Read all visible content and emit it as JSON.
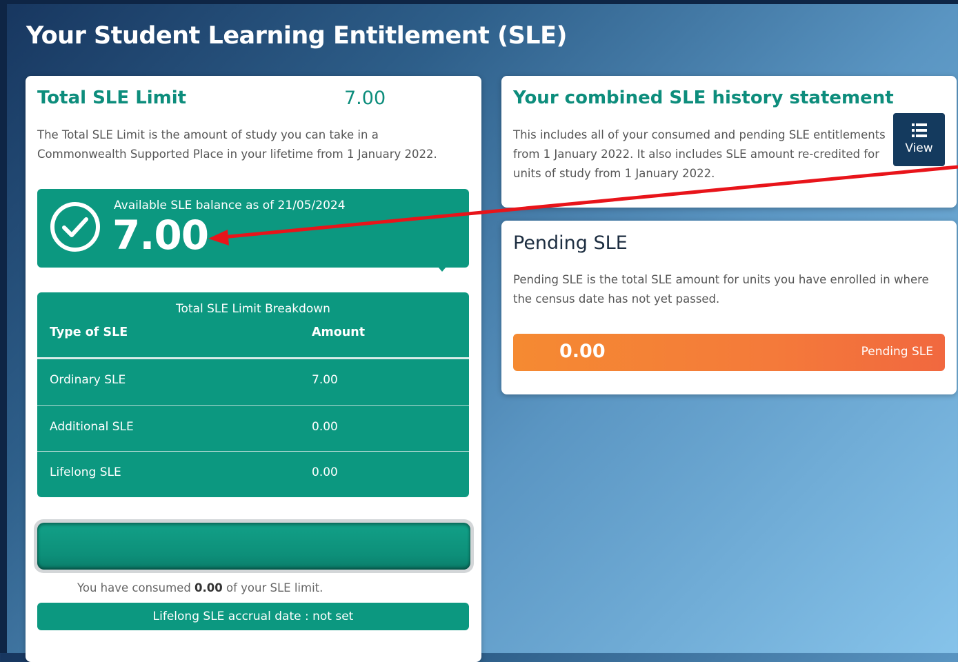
{
  "page": {
    "title": "Your Student Learning Entitlement (SLE)"
  },
  "total_limit": {
    "title": "Total SLE Limit",
    "value": "7.00",
    "description": "The Total SLE Limit is the amount of study you can take in a Commonwealth Supported Place in your lifetime from 1 January 2022."
  },
  "balance": {
    "label": "Available SLE balance as of 21/05/2024",
    "value": "7.00",
    "icon": "check-circle-icon"
  },
  "breakdown": {
    "caption": "Total SLE Limit Breakdown",
    "headers": [
      "Type of SLE",
      "Amount"
    ],
    "rows": [
      {
        "type": "Ordinary SLE",
        "amount": "7.00"
      },
      {
        "type": "Additional SLE",
        "amount": "0.00"
      },
      {
        "type": "Lifelong SLE",
        "amount": "0.00"
      }
    ]
  },
  "consumption": {
    "progress_fraction": 0,
    "text_prefix": "You have consumed",
    "consumed": "0.00",
    "text_suffix": "of your SLE limit."
  },
  "accrual": {
    "text": "Lifelong SLE accrual date : not set"
  },
  "history": {
    "title": "Your combined SLE history statement",
    "description": "This includes all of your consumed and pending SLE entitlements from 1 January 2022. It also includes SLE amount re-credited for units of study from 1 January 2022.",
    "view_label": "View",
    "view_icon": "list-icon"
  },
  "pending": {
    "title": "Pending SLE",
    "description": "Pending SLE is the total SLE amount for units you have enrolled in where the census date has not yet passed.",
    "value": "0.00",
    "label": "Pending SLE"
  },
  "colors": {
    "teal": "#0c9880",
    "navy": "#143a5e",
    "orange": "#f47a3a",
    "annotation_red": "#e8141a"
  }
}
